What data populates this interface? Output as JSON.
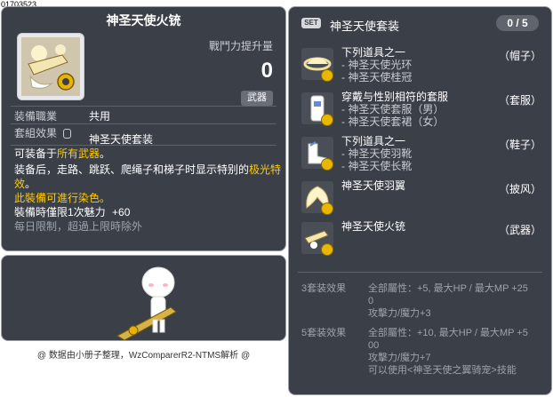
{
  "id_label": "01703523",
  "item": {
    "title": "神圣天使火铳",
    "power_label": "戰鬥力提升量",
    "power_value": "0",
    "weapon_badge": "武器",
    "job_key": "装備職業",
    "job_val": "共用",
    "set_key": "套組效果",
    "set_val": "神圣天使套装",
    "desc1_a": "可装备于",
    "desc1_b": "所有武器",
    "desc1_c": "。",
    "desc2_a": "装备后，走路、跳跃、爬绳子和梯子时显示特别的",
    "desc2_b": "极光特",
    "desc3_b": "效",
    "desc3_c": "。",
    "desc4": "此裝備可進行染色。",
    "desc5_a": "裝備時僅限1次魅力",
    "desc5_b": "+60",
    "desc6": "每日限制，超過上限時除外"
  },
  "credit": "@ 数据由小册子整理，WzComparerR2-NTMS解析 @",
  "set": {
    "badge": "SET",
    "name": "神圣天使套装",
    "count": "0 / 5",
    "items": [
      {
        "lines": [
          "下列道具之一",
          "- 神圣天使光环",
          "- 神圣天使桂冠"
        ],
        "category": "（帽子）"
      },
      {
        "lines": [
          "穿戴与性别相符的套服",
          "- 神圣天使套服（男）",
          "- 神圣天使套裙（女）"
        ],
        "category": "（套服）"
      },
      {
        "lines": [
          "下列道具之一",
          "- 神圣天使羽靴",
          "- 神圣天使长靴"
        ],
        "category": "（鞋子）"
      },
      {
        "lines": [
          "神圣天使羽翼"
        ],
        "category": "（披风）"
      },
      {
        "lines": [
          "神圣天使火铳"
        ],
        "category": "（武器）"
      }
    ],
    "bonuses": [
      {
        "label": "3套装效果",
        "line1": "全部屬性：+5, 最大HP / 最大MP  +25",
        "line2": "0",
        "line3": "攻擊力/魔力+3",
        "line4": ""
      },
      {
        "label": "5套装效果",
        "line1": "全部屬性：+10, 最大HP / 最大MP  +5",
        "line2": "00",
        "line3": "攻擊力/魔力+7",
        "line4": "可以使用<神圣天使之翼骑宠>技能"
      }
    ]
  },
  "colors": {
    "panel_bg": "#3b3f47",
    "highlight": "#ffcc00",
    "border": "#9aa0a8"
  }
}
